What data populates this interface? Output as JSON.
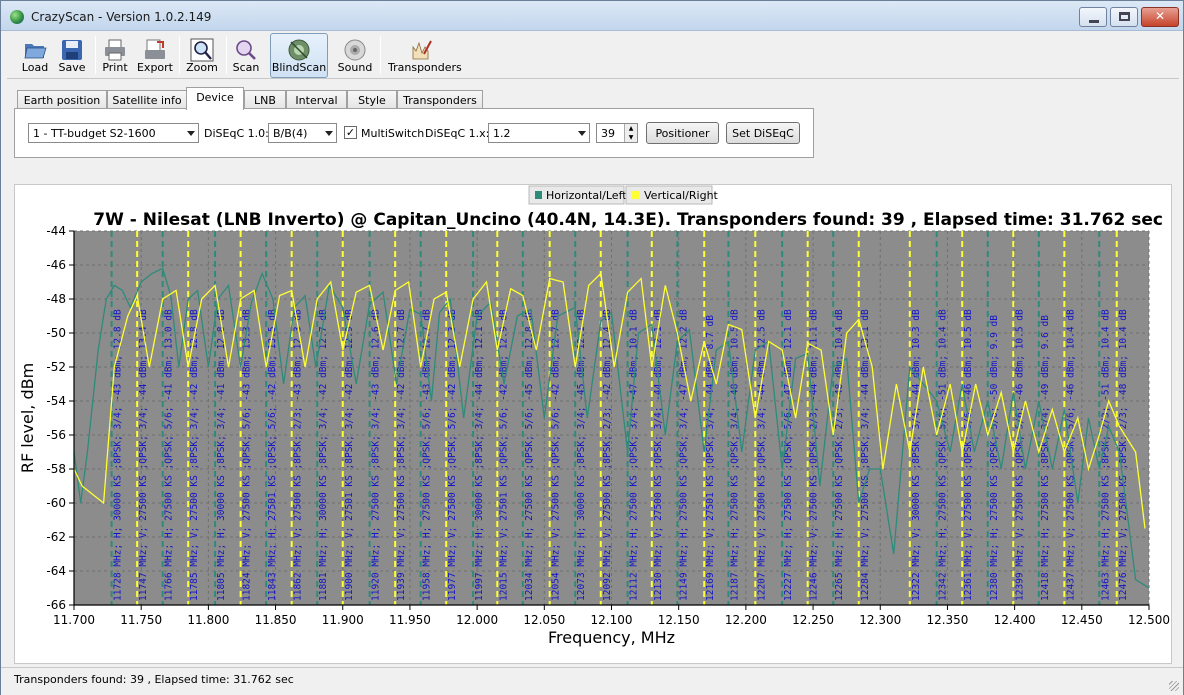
{
  "window": {
    "title": "CrazyScan - Version 1.0.2.149"
  },
  "toolbar": {
    "buttons": [
      {
        "label": "Load",
        "icon": "folder-open-icon"
      },
      {
        "label": "Save",
        "icon": "floppy-disk-icon"
      },
      {
        "label": "Print",
        "icon": "printer-icon"
      },
      {
        "label": "Export",
        "icon": "export-icon"
      },
      {
        "label": "Zoom",
        "icon": "zoom-icon"
      },
      {
        "label": "Scan",
        "icon": "scan-icon"
      },
      {
        "label": "BlindScan",
        "icon": "satellite-dish-icon"
      },
      {
        "label": "Sound",
        "icon": "speaker-icon"
      },
      {
        "label": "Transponders",
        "icon": "transponders-edit-icon"
      }
    ]
  },
  "tabs": [
    {
      "label": "Earth position"
    },
    {
      "label": "Satellite info"
    },
    {
      "label": "Device"
    },
    {
      "label": "LNB"
    },
    {
      "label": "Interval"
    },
    {
      "label": "Style"
    },
    {
      "label": "Transponders"
    }
  ],
  "device": {
    "tuner_value": "1 - TT-budget S2-1600",
    "diseqc10_label": "DiSEqC 1.0:",
    "diseqc10_value": "B/B(4)",
    "multiswitch_label": "MultiSwitch",
    "multiswitch_checked": "✓",
    "diseqc1x_label": "DiSEqC 1.x:",
    "diseqc1x_value": "1.2",
    "position_value": "39",
    "positioner_button": "Positioner",
    "set_diseqc_button": "Set DiSEqC"
  },
  "chart_data": {
    "type": "line",
    "title": "7W - Nilesat (LNB Inverto) @ Capitan_Uncino (40.4N, 14.3E). Transponders found: 39 , Elapsed time: 31.762 sec",
    "xlabel": "Frequency, MHz",
    "ylabel": "RF level, dBm",
    "xlim": [
      11700,
      12500
    ],
    "ylim": [
      -66,
      -44
    ],
    "x_ticks": [
      "11.700",
      "11.750",
      "11.800",
      "11.850",
      "11.900",
      "11.950",
      "12.000",
      "12.050",
      "12.100",
      "12.150",
      "12.200",
      "12.250",
      "12.300",
      "12.350",
      "12.400",
      "12.450",
      "12.500"
    ],
    "y_ticks": [
      "-44",
      "-46",
      "-48",
      "-50",
      "-52",
      "-54",
      "-56",
      "-58",
      "-60",
      "-62",
      "-64",
      "-66"
    ],
    "legend": [
      "Horizontal/Left",
      "Vertical/Right"
    ],
    "legend_position": "top",
    "colors": {
      "horizontal": "#2e8b7a",
      "vertical": "#ffff33",
      "plot_bg": "#8c8c8c",
      "label": "#1414c8"
    },
    "series": [
      {
        "name": "Horizontal/Left",
        "x": [
          11700,
          11705,
          11710,
          11718,
          11724,
          11730,
          11736,
          11742,
          11750,
          11758,
          11766,
          11772,
          11778,
          11785,
          11792,
          11800,
          11807,
          11815,
          11824,
          11832,
          11840,
          11848,
          11856,
          11864,
          11872,
          11880,
          11890,
          11900,
          11910,
          11920,
          11930,
          11940,
          11950,
          11958,
          11966,
          11972,
          11980,
          11990,
          12000,
          12010,
          12020,
          12030,
          12040,
          12050,
          12060,
          12073,
          12082,
          12092,
          12100,
          12112,
          12120,
          12130,
          12140,
          12149,
          12158,
          12169,
          12178,
          12187,
          12197,
          12207,
          12217,
          12227,
          12237,
          12246,
          12255,
          12265,
          12275,
          12284,
          12292,
          12300,
          12310,
          12322,
          12332,
          12342,
          12352,
          12361,
          12370,
          12380,
          12390,
          12399,
          12408,
          12418,
          12428,
          12437,
          12447,
          12455,
          12463,
          12470,
          12478,
          12490,
          12500
        ],
        "values": [
          -57,
          -60,
          -57,
          -51,
          -48,
          -47.2,
          -47.5,
          -48.5,
          -47,
          -46.5,
          -46.2,
          -47.8,
          -52,
          -48,
          -47.5,
          -52,
          -48,
          -47.2,
          -52,
          -48.2,
          -46.5,
          -48,
          -53,
          -48.5,
          -47.8,
          -52,
          -47.2,
          -48.5,
          -53,
          -48.3,
          -47.6,
          -53,
          -48.6,
          -48.9,
          -54,
          -48.8,
          -48,
          -55,
          -49,
          -48.2,
          -53,
          -49,
          -48.6,
          -55,
          -49,
          -48.5,
          -55,
          -49.3,
          -48.8,
          -57,
          -50,
          -49.5,
          -56,
          -50.5,
          -49.8,
          -57,
          -51,
          -50.5,
          -57,
          -51,
          -50.5,
          -58,
          -51.5,
          -51.2,
          -59,
          -52,
          -51.5,
          -60,
          -58,
          -58,
          -63,
          -52,
          -53,
          -54,
          -57,
          -53,
          -57,
          -54,
          -58,
          -53.5,
          -58,
          -54,
          -58,
          -54.5,
          -60,
          -55,
          -58,
          -55.5,
          -57,
          -64.5,
          -65
        ]
      },
      {
        "name": "Vertical/Right",
        "x": [
          11700,
          11706,
          11714,
          11722,
          11730,
          11740,
          11747,
          11756,
          11766,
          11776,
          11785,
          11795,
          11805,
          11815,
          11824,
          11834,
          11843,
          11853,
          11862,
          11872,
          11881,
          11891,
          11900,
          11910,
          11920,
          11930,
          11939,
          11949,
          11958,
          11968,
          11977,
          11987,
          11997,
          12007,
          12015,
          12025,
          12034,
          12044,
          12054,
          12064,
          12073,
          12083,
          12092,
          12102,
          12112,
          12122,
          12130,
          12140,
          12149,
          12159,
          12169,
          12178,
          12187,
          12197,
          12207,
          12217,
          12227,
          12237,
          12246,
          12256,
          12265,
          12275,
          12284,
          12294,
          12302,
          12312,
          12322,
          12332,
          12342,
          12352,
          12361,
          12371,
          12380,
          12390,
          12399,
          12408,
          12418,
          12428,
          12437,
          12447,
          12455,
          12463,
          12470,
          12478,
          12490,
          12497
        ],
        "values": [
          -58,
          -59,
          -59.5,
          -60,
          -52,
          -49,
          -47.8,
          -52,
          -48,
          -47.5,
          -52,
          -48,
          -47.2,
          -52,
          -48,
          -47.5,
          -52,
          -47.8,
          -47.5,
          -52,
          -48,
          -47,
          -51,
          -47.6,
          -47.2,
          -51,
          -47.5,
          -47,
          -52,
          -48,
          -47.6,
          -52,
          -48,
          -47,
          -51,
          -47.4,
          -47.8,
          -51,
          -46.8,
          -47,
          -52,
          -47.2,
          -46.5,
          -52,
          -47.6,
          -46.8,
          -52,
          -47.2,
          -50,
          -54,
          -50.5,
          -53,
          -49.5,
          -49.8,
          -55,
          -50.5,
          -51,
          -55,
          -50.6,
          -51,
          -56,
          -50,
          -49.2,
          -52,
          -58,
          -53,
          -57,
          -52,
          -56,
          -53,
          -57,
          -53,
          -56,
          -53.5,
          -57,
          -54,
          -57,
          -54.5,
          -57,
          -55,
          -58,
          -56,
          -54,
          -55.5,
          -57,
          -61.5
        ]
      }
    ],
    "transponders": [
      {
        "freq": 11728,
        "label": "11728 MHz; H; 30000 KS ;8PSK; 3/4; -43 dBm; 12.8 dB",
        "pol": "H"
      },
      {
        "freq": 11747,
        "label": "11747 MHz; V; 27500 KS ;QPSK; 3/4; -44 dBm; 13.4 dB",
        "pol": "V"
      },
      {
        "freq": 11766,
        "label": "11766 MHz; H; 27500 KS ;QPSK; 5/6; -41 dBm; 13.0 dB",
        "pol": "H"
      },
      {
        "freq": 11785,
        "label": "11785 MHz; V; 27500 KS ;8PSK; 3/4; -42 dBm; 12.8 dB",
        "pol": "V"
      },
      {
        "freq": 11805,
        "label": "11805 MHz; H; 30000 KS ;8PSK; 3/4; -41 dBm; 12.8 dB",
        "pol": "H"
      },
      {
        "freq": 11824,
        "label": "11824 MHz; V; 27500 KS ;QPSK; 5/6; -43 dBm; 13.3 dB",
        "pol": "V"
      },
      {
        "freq": 11843,
        "label": "11843 MHz; H; 27501 KS ;QPSK; 5/6; -42 dBm; 13.5 dB",
        "pol": "H"
      },
      {
        "freq": 11862,
        "label": "11862 MHz; V; 27500 KS ;8PSK; 2/3; -43 dBm; 12.3 dB",
        "pol": "V"
      },
      {
        "freq": 11881,
        "label": "11881 MHz; H; 30000 KS ;8PSK; 3/4; -42 dBm; 12.7 dB",
        "pol": "H"
      },
      {
        "freq": 11900,
        "label": "11900 MHz; V; 27501 KS ;8PSK; 3/4; -42 dBm; 12.9 dB",
        "pol": "V"
      },
      {
        "freq": 11920,
        "label": "11920 MHz; H; 27500 KS ;8PSK; 3/4; -43 dBm; 12.6 dB",
        "pol": "H"
      },
      {
        "freq": 11939,
        "label": "11939 MHz; V; 27500 KS ;8PSK; 3/4; -42 dBm; 12.7 dB",
        "pol": "V"
      },
      {
        "freq": 11958,
        "label": "11958 MHz; H; 27500 KS ;QPSK; 5/6; -43 dBm; 12.7 dB",
        "pol": "H"
      },
      {
        "freq": 11977,
        "label": "11977 MHz; V; 27500 KS ;QPSK; 5/6; -42 dBm; 12.3 dB",
        "pol": "V"
      },
      {
        "freq": 11997,
        "label": "11997 MHz; H; 30000 KS ;8PSK; 3/4; -44 dBm; 12.1 dB",
        "pol": "H"
      },
      {
        "freq": 12015,
        "label": "12015 MHz; V; 27501 KS ;QPSK; 5/6; -42 dBm; 12.9 dB",
        "pol": "V"
      },
      {
        "freq": 12034,
        "label": "12034 MHz; H; 27500 KS ;QPSK; 5/6; -45 dBm; 12.8 dB",
        "pol": "H"
      },
      {
        "freq": 12054,
        "label": "12054 MHz; V; 27500 KS ;QPSK; 5/6; -42 dBm; 12.7 dB",
        "pol": "V"
      },
      {
        "freq": 12073,
        "label": "12073 MHz; H; 30000 KS ;8PSK; 3/4; -45 dBm; 12.1 dB",
        "pol": "H"
      },
      {
        "freq": 12092,
        "label": "12092 MHz; V; 27500 KS ;8PSK; 2/3; -42 dBm; 12.4 dB",
        "pol": "V"
      },
      {
        "freq": 12112,
        "label": "12112 MHz; H; 27500 KS ;QPSK; 3/4; -47 dBm; 10.1 dB",
        "pol": "H"
      },
      {
        "freq": 12130,
        "label": "12130 MHz; V; 27500 KS ;QPSK; 3/4; -44 dBm; 12.1 dB",
        "pol": "V"
      },
      {
        "freq": 12149,
        "label": "12149 MHz; H; 27500 KS ;QPSK; 3/4; -47 dBm; 12.2 dB",
        "pol": "H"
      },
      {
        "freq": 12169,
        "label": "12169 MHz; V; 27501 KS ;QPSK; 3/4; -44 dBm; 8.7 dB",
        "pol": "V"
      },
      {
        "freq": 12187,
        "label": "12187 MHz; H; 27500 KS ;QPSK; 3/4; -48 dBm; 10.5 dB",
        "pol": "H"
      },
      {
        "freq": 12207,
        "label": "12207 MHz; V; 27500 KS ;QPSK; 3/4; -44 dBm; 12.5 dB",
        "pol": "V"
      },
      {
        "freq": 12227,
        "label": "12227 MHz; H; 27500 KS ;QPSK; 5/6; -47 dBm; 12.1 dB",
        "pol": "H"
      },
      {
        "freq": 12246,
        "label": "12246 MHz; V; 27500 KS ;QPSK; 2/3; -44 dBm; 11.1 dB",
        "pol": "V"
      },
      {
        "freq": 12265,
        "label": "12265 MHz; H; 27500 KS ;QPSK; 2/3; -48 dBm; 10.4 dB",
        "pol": "H"
      },
      {
        "freq": 12284,
        "label": "12284 MHz; V; 27500 KS ;8PSK; 3/4; -44 dBm; 13.1 dB",
        "pol": "V"
      },
      {
        "freq": 12322,
        "label": "12322 MHz; V; 30000 KS ;8PSK; 3/4; -44 dBm; 10.3 dB",
        "pol": "V"
      },
      {
        "freq": 12342,
        "label": "12342 MHz; H; 27500 KS ;QPSK; 5/6; -51 dBm; 10.4 dB",
        "pol": "H"
      },
      {
        "freq": 12361,
        "label": "12361 MHz; V; 27500 KS ;QPSK; 5/6; -46 dBm; 10.5 dB",
        "pol": "V"
      },
      {
        "freq": 12380,
        "label": "12380 MHz; H; 27500 KS ;QPSK; 5/6; -50 dBm; 9.9 dB",
        "pol": "H"
      },
      {
        "freq": 12399,
        "label": "12399 MHz; V; 27500 KS ;QPSK; 5/6; -46 dBm; 10.5 dB",
        "pol": "V"
      },
      {
        "freq": 12418,
        "label": "12418 MHz; H; 27500 KS ;8PSK; 3/4; -49 dBm; 9.6 dB",
        "pol": "H"
      },
      {
        "freq": 12437,
        "label": "12437 MHz; V; 27500 KS ;QPSK; 5/6; -46 dBm; 10.4 dB",
        "pol": "V"
      },
      {
        "freq": 12463,
        "label": "12463 MHz; H; 27500 KS ;8PSK; 2/3; -51 dBm; 10.4 dB",
        "pol": "H"
      },
      {
        "freq": 12476,
        "label": "12476 MHz; V; 27500 KS ;8PSK; 2/3; -48 dBm; 10.4 dB",
        "pol": "V"
      }
    ]
  },
  "status": {
    "text": "Transponders found: 39 , Elapsed time: 31.762 sec"
  }
}
